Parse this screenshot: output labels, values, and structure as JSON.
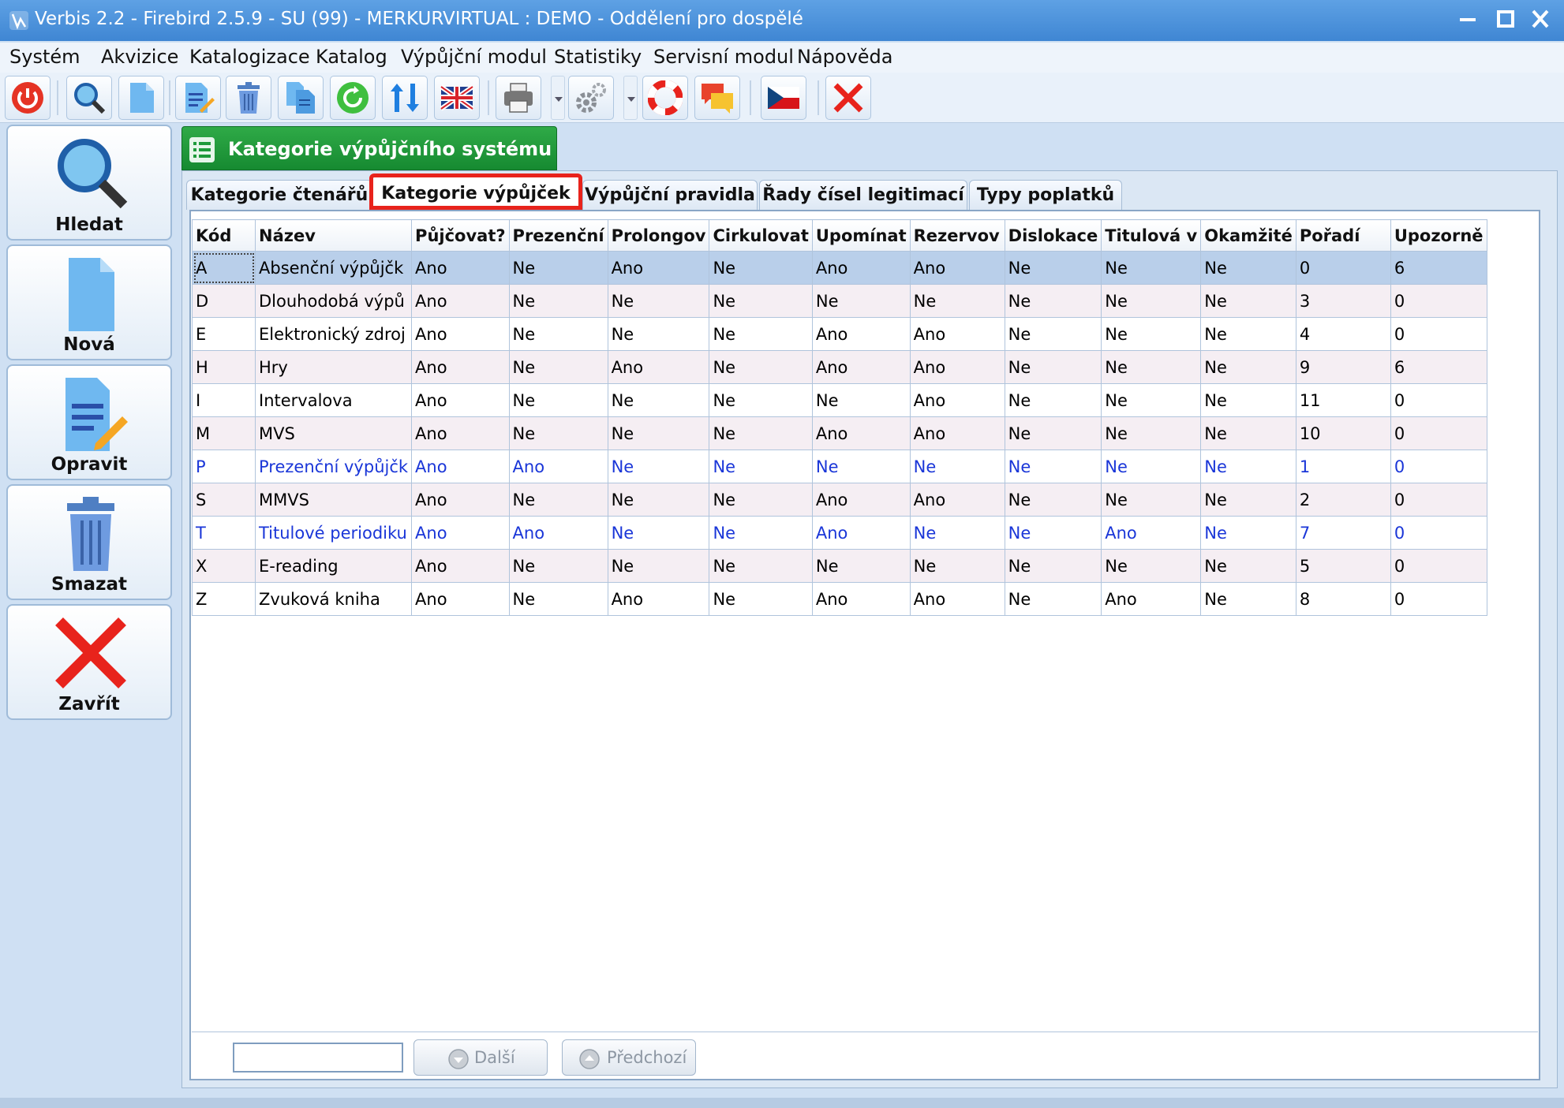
{
  "window": {
    "title": "Verbis 2.2 - Firebird 2.5.9 - SU (99) - MERKURVIRTUAL : DEMO - Oddělení pro dospělé"
  },
  "menu": [
    "Systém",
    "Akvizice",
    "Katalogizace",
    "Katalog",
    "Výpůjční modul",
    "Statistiky",
    "Servisní modul",
    "Nápověda"
  ],
  "toolbar": {
    "icons": [
      "power-icon",
      "search-icon",
      "new-document-icon",
      "edit-icon",
      "trash-icon",
      "copy-documents-icon",
      "refresh-icon",
      "sort-icon",
      "uk-flag-icon",
      "printer-icon",
      "gear-icon",
      "lifebuoy-icon",
      "chat-icon",
      "cz-flag-icon",
      "close-icon"
    ]
  },
  "sidebar": {
    "search": "Hledat",
    "new": "Nová",
    "edit": "Opravit",
    "delete": "Smazat",
    "close": "Zavřít"
  },
  "panel": {
    "title": "Kategorie výpůjčního systému"
  },
  "tabs": [
    "Kategorie čtenářů",
    "Kategorie výpůjček",
    "Výpůjční pravidla",
    "Řady čísel legitimací",
    "Typy poplatků"
  ],
  "active_tab": 1,
  "table": {
    "columns": [
      "Kód",
      "Název",
      "Půjčovat?",
      "Prezenční",
      "Prolongov",
      "Cirkulovat",
      "Upomínat",
      "Rezervov",
      "Dislokace",
      "Titulová v",
      "Okamžité",
      "Pořadí",
      "Upozorně"
    ],
    "rows": [
      [
        "A",
        "Absenční výpůjčk",
        "Ano",
        "Ne",
        "Ano",
        "Ne",
        "Ano",
        "Ano",
        "Ne",
        "Ne",
        "Ne",
        "0",
        "6"
      ],
      [
        "D",
        "Dlouhodobá výpů",
        "Ano",
        "Ne",
        "Ne",
        "Ne",
        "Ne",
        "Ne",
        "Ne",
        "Ne",
        "Ne",
        "3",
        "0"
      ],
      [
        "E",
        "Elektronický zdroj",
        "Ano",
        "Ne",
        "Ne",
        "Ne",
        "Ano",
        "Ano",
        "Ne",
        "Ne",
        "Ne",
        "4",
        "0"
      ],
      [
        "H",
        "Hry",
        "Ano",
        "Ne",
        "Ano",
        "Ne",
        "Ano",
        "Ano",
        "Ne",
        "Ne",
        "Ne",
        "9",
        "6"
      ],
      [
        "I",
        "Intervalova",
        "Ano",
        "Ne",
        "Ne",
        "Ne",
        "Ne",
        "Ano",
        "Ne",
        "Ne",
        "Ne",
        "11",
        "0"
      ],
      [
        "M",
        "MVS",
        "Ano",
        "Ne",
        "Ne",
        "Ne",
        "Ano",
        "Ano",
        "Ne",
        "Ne",
        "Ne",
        "10",
        "0"
      ],
      [
        "P",
        "Prezenční výpůjčk",
        "Ano",
        "Ano",
        "Ne",
        "Ne",
        "Ne",
        "Ne",
        "Ne",
        "Ne",
        "Ne",
        "1",
        "0"
      ],
      [
        "S",
        "MMVS",
        "Ano",
        "Ne",
        "Ne",
        "Ne",
        "Ano",
        "Ano",
        "Ne",
        "Ne",
        "Ne",
        "2",
        "0"
      ],
      [
        "T",
        "Titulové periodiku",
        "Ano",
        "Ano",
        "Ne",
        "Ne",
        "Ano",
        "Ne",
        "Ne",
        "Ano",
        "Ne",
        "7",
        "0"
      ],
      [
        "X",
        "E-reading",
        "Ano",
        "Ne",
        "Ne",
        "Ne",
        "Ne",
        "Ne",
        "Ne",
        "Ne",
        "Ne",
        "5",
        "0"
      ],
      [
        "Z",
        "Zvuková kniha",
        "Ano",
        "Ne",
        "Ano",
        "Ne",
        "Ano",
        "Ano",
        "Ne",
        "Ano",
        "Ne",
        "8",
        "0"
      ]
    ],
    "selected_row": 0,
    "blue_rows": [
      6,
      8
    ]
  },
  "footer": {
    "search_value": "",
    "next": "Další",
    "prev": "Předchozí"
  },
  "colors": {
    "accent_green": "#1e9a3a",
    "highlight_red": "#e8231c",
    "blue_text": "#1a36d8",
    "selection": "#b9cfea"
  }
}
